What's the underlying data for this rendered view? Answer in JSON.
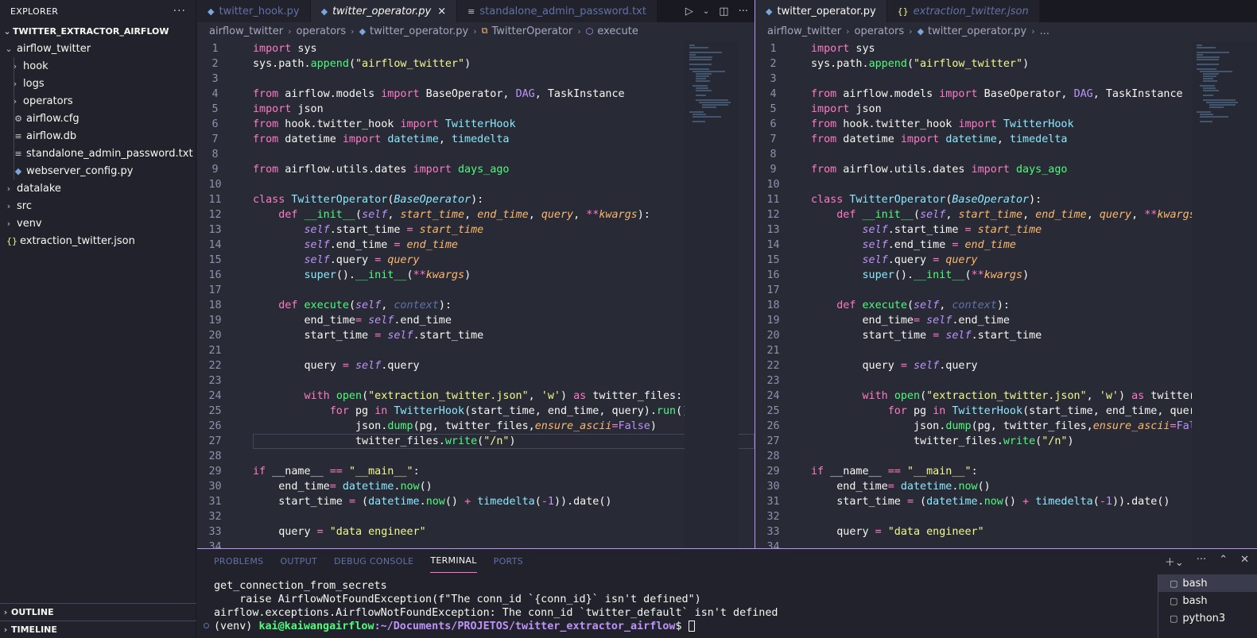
{
  "sidebar": {
    "title": "EXPLORER",
    "more_icon": "ellipsis-icon",
    "root": "TWITTER_EXTRACTOR_AIRFLOW",
    "items": [
      {
        "label": "airflow_twitter",
        "kind": "folder-open",
        "depth": 1
      },
      {
        "label": "hook",
        "kind": "folder",
        "depth": 2
      },
      {
        "label": "logs",
        "kind": "folder",
        "depth": 2
      },
      {
        "label": "operators",
        "kind": "folder",
        "depth": 2
      },
      {
        "label": "airflow.cfg",
        "kind": "gear-file",
        "depth": 2
      },
      {
        "label": "airflow.db",
        "kind": "text-file",
        "depth": 2
      },
      {
        "label": "standalone_admin_password.txt",
        "kind": "text-file",
        "depth": 2
      },
      {
        "label": "webserver_config.py",
        "kind": "python-file",
        "depth": 2
      },
      {
        "label": "datalake",
        "kind": "folder",
        "depth": 1
      },
      {
        "label": "src",
        "kind": "folder",
        "depth": 1
      },
      {
        "label": "venv",
        "kind": "folder",
        "depth": 1
      },
      {
        "label": "extraction_twitter.json",
        "kind": "json-file",
        "depth": 1
      }
    ],
    "outline": "OUTLINE",
    "timeline": "TIMELINE"
  },
  "left_editor": {
    "tabs": [
      {
        "label": "twitter_hook.py",
        "icon": "python-icon",
        "active": false
      },
      {
        "label": "twitter_operator.py",
        "icon": "python-icon",
        "active": true
      },
      {
        "label": "standalone_admin_password.txt",
        "icon": "text-file-icon",
        "active": false
      }
    ],
    "close": "×",
    "breadcrumbs": [
      "airflow_twitter",
      "operators",
      "twitter_operator.py",
      "TwitterOperator",
      "execute"
    ]
  },
  "right_editor": {
    "tabs": [
      {
        "label": "twitter_operator.py",
        "icon": "python-icon",
        "active": true
      },
      {
        "label": "extraction_twitter.json",
        "icon": "json-icon",
        "active": false
      }
    ],
    "breadcrumbs": [
      "airflow_twitter",
      "operators",
      "twitter_operator.py",
      "..."
    ]
  },
  "code_lines": [
    [
      [
        "kw",
        "import"
      ],
      [
        "t",
        " sys"
      ]
    ],
    [
      [
        "t",
        "sys.path."
      ],
      [
        "fn",
        "append"
      ],
      [
        "t",
        "("
      ],
      [
        "st",
        "\"airflow_twitter\""
      ],
      [
        "t",
        ")"
      ]
    ],
    [],
    [
      [
        "kw",
        "from"
      ],
      [
        "t",
        " airflow.models "
      ],
      [
        "kw",
        "import"
      ],
      [
        "t",
        " BaseOperator, "
      ],
      [
        "sf2",
        "DAG"
      ],
      [
        "t",
        ", TaskInstance"
      ]
    ],
    [
      [
        "kw",
        "import"
      ],
      [
        "t",
        " json"
      ]
    ],
    [
      [
        "kw",
        "from"
      ],
      [
        "t",
        " hook.twitter_hook "
      ],
      [
        "kw",
        "import"
      ],
      [
        "t",
        " "
      ],
      [
        "cls",
        "TwitterHook"
      ]
    ],
    [
      [
        "kw",
        "from"
      ],
      [
        "t",
        " datetime "
      ],
      [
        "kw",
        "import"
      ],
      [
        "t",
        " "
      ],
      [
        "cls",
        "datetime"
      ],
      [
        "t",
        ", "
      ],
      [
        "cls",
        "timedelta"
      ]
    ],
    [],
    [
      [
        "kw",
        "from"
      ],
      [
        "t",
        " airflow.utils.dates "
      ],
      [
        "kw",
        "import"
      ],
      [
        "t",
        " "
      ],
      [
        "fn",
        "days_ago"
      ]
    ],
    [],
    [
      [
        "kw",
        "class"
      ],
      [
        "t",
        " "
      ],
      [
        "cls",
        "TwitterOperator"
      ],
      [
        "t",
        "("
      ],
      [
        "clsi",
        "BaseOperator"
      ],
      [
        "t",
        "):"
      ]
    ],
    [
      [
        "t",
        "    "
      ],
      [
        "kw",
        "def"
      ],
      [
        "t",
        " "
      ],
      [
        "fn",
        "__init__"
      ],
      [
        "t",
        "("
      ],
      [
        "sf",
        "self"
      ],
      [
        "t",
        ", "
      ],
      [
        "pa",
        "start_time"
      ],
      [
        "t",
        ", "
      ],
      [
        "pa",
        "end_time"
      ],
      [
        "t",
        ", "
      ],
      [
        "pa",
        "query"
      ],
      [
        "t",
        ", "
      ],
      [
        "kw",
        "**"
      ],
      [
        "pa",
        "kwargs"
      ],
      [
        "t",
        "):"
      ]
    ],
    [
      [
        "t",
        "        "
      ],
      [
        "sf",
        "self"
      ],
      [
        "t",
        ".start_time "
      ],
      [
        "kw",
        "="
      ],
      [
        "t",
        " "
      ],
      [
        "pa",
        "start_time"
      ]
    ],
    [
      [
        "t",
        "        "
      ],
      [
        "sf",
        "self"
      ],
      [
        "t",
        ".end_time "
      ],
      [
        "kw",
        "="
      ],
      [
        "t",
        " "
      ],
      [
        "pa",
        "end_time"
      ]
    ],
    [
      [
        "t",
        "        "
      ],
      [
        "sf",
        "self"
      ],
      [
        "t",
        ".query "
      ],
      [
        "kw",
        "="
      ],
      [
        "t",
        " "
      ],
      [
        "pa",
        "query"
      ]
    ],
    [
      [
        "t",
        "        "
      ],
      [
        "bi",
        "super"
      ],
      [
        "t",
        "()."
      ],
      [
        "fn",
        "__init__"
      ],
      [
        "t",
        "("
      ],
      [
        "kw",
        "**"
      ],
      [
        "pa",
        "kwargs"
      ],
      [
        "t",
        ")"
      ]
    ],
    [],
    [
      [
        "t",
        "    "
      ],
      [
        "kw",
        "def"
      ],
      [
        "t",
        " "
      ],
      [
        "fn",
        "execute"
      ],
      [
        "t",
        "("
      ],
      [
        "sf",
        "self"
      ],
      [
        "t",
        ", "
      ],
      [
        "cm",
        "context"
      ],
      [
        "t",
        "):"
      ]
    ],
    [
      [
        "t",
        "        end_time"
      ],
      [
        "kw",
        "="
      ],
      [
        "t",
        " "
      ],
      [
        "sf",
        "self"
      ],
      [
        "t",
        ".end_time"
      ]
    ],
    [
      [
        "t",
        "        start_time "
      ],
      [
        "kw",
        "="
      ],
      [
        "t",
        " "
      ],
      [
        "sf",
        "self"
      ],
      [
        "t",
        ".start_time"
      ]
    ],
    [],
    [
      [
        "t",
        "        query "
      ],
      [
        "kw",
        "="
      ],
      [
        "t",
        " "
      ],
      [
        "sf",
        "self"
      ],
      [
        "t",
        ".query"
      ]
    ],
    [],
    [
      [
        "t",
        "        "
      ],
      [
        "kw",
        "with"
      ],
      [
        "t",
        " "
      ],
      [
        "fn",
        "open"
      ],
      [
        "t",
        "("
      ],
      [
        "st",
        "\"extraction_twitter.json\""
      ],
      [
        "t",
        ", "
      ],
      [
        "st",
        "'w'"
      ],
      [
        "t",
        ") "
      ],
      [
        "kw",
        "as"
      ],
      [
        "t",
        " twitter_files:"
      ]
    ],
    [
      [
        "t",
        "            "
      ],
      [
        "kw",
        "for"
      ],
      [
        "t",
        " pg "
      ],
      [
        "kw",
        "in"
      ],
      [
        "t",
        " "
      ],
      [
        "cls",
        "TwitterHook"
      ],
      [
        "t",
        "(start_time, end_time, query)."
      ],
      [
        "fn",
        "run"
      ],
      [
        "t",
        "():"
      ]
    ],
    [
      [
        "t",
        "                json."
      ],
      [
        "fn",
        "dump"
      ],
      [
        "t",
        "(pg, twitter_files,"
      ],
      [
        "pa",
        "ensure_ascii"
      ],
      [
        "kw",
        "="
      ],
      [
        "nu",
        "False"
      ],
      [
        "t",
        ")"
      ]
    ],
    [
      [
        "t",
        "                twitter_files."
      ],
      [
        "fn",
        "write"
      ],
      [
        "t",
        "("
      ],
      [
        "st",
        "\"/n\""
      ],
      [
        "t",
        ")"
      ]
    ],
    [],
    [
      [
        "kw",
        "if"
      ],
      [
        "t",
        " __name__ "
      ],
      [
        "kw",
        "=="
      ],
      [
        "t",
        " "
      ],
      [
        "st",
        "\"__main__\""
      ],
      [
        "t",
        ":"
      ]
    ],
    [
      [
        "t",
        "    end_time"
      ],
      [
        "kw",
        "="
      ],
      [
        "t",
        " "
      ],
      [
        "cls",
        "datetime"
      ],
      [
        "t",
        "."
      ],
      [
        "fn",
        "now"
      ],
      [
        "t",
        "()"
      ]
    ],
    [
      [
        "t",
        "    start_time "
      ],
      [
        "kw",
        "="
      ],
      [
        "t",
        " ("
      ],
      [
        "cls",
        "datetime"
      ],
      [
        "t",
        "."
      ],
      [
        "fn",
        "now"
      ],
      [
        "t",
        "() "
      ],
      [
        "kw",
        "+"
      ],
      [
        "t",
        " "
      ],
      [
        "cls",
        "timedelta"
      ],
      [
        "t",
        "("
      ],
      [
        "kw",
        "-"
      ],
      [
        "nu",
        "1"
      ],
      [
        "t",
        ")).date()"
      ]
    ],
    [],
    [
      [
        "t",
        "    query "
      ],
      [
        "kw",
        "="
      ],
      [
        "t",
        " "
      ],
      [
        "st",
        "\"data engineer\""
      ]
    ],
    []
  ],
  "panel": {
    "tabs": [
      "PROBLEMS",
      "OUTPUT",
      "DEBUG CONSOLE",
      "TERMINAL",
      "PORTS"
    ],
    "active_tab": "TERMINAL",
    "terminal_lines": [
      "get_connection_from_secrets",
      "    raise AirflowNotFoundException(f\"The conn_id `{conn_id}` isn't defined\")",
      "airflow.exceptions.AirflowNotFoundException: The conn_id `twitter_default` isn't defined"
    ],
    "prompt_venv": "(venv) ",
    "prompt_user": "kai@kaiwangairflow",
    "prompt_path": ":~/Documents/PROJETOS/twitter_extractor_airflow",
    "prompt_end": "$ ",
    "terminals": [
      "bash",
      "bash",
      "python3"
    ]
  }
}
